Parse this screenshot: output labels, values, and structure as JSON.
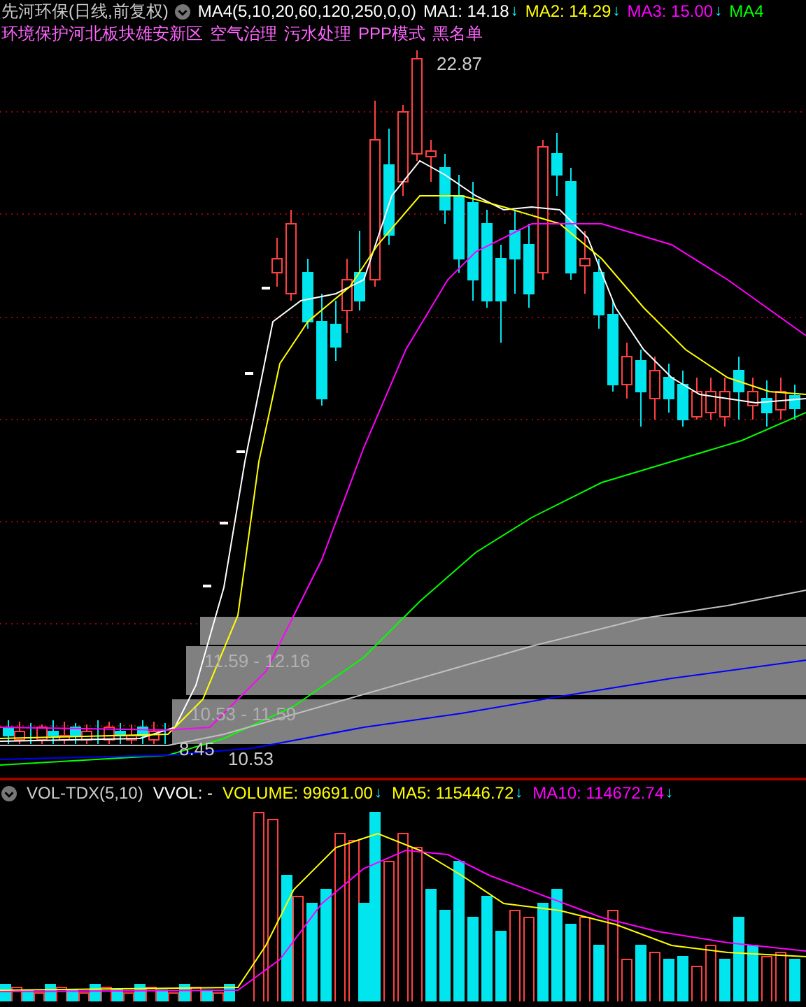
{
  "header": {
    "title": "先河环保(日线,前复权)",
    "indicator": "MA4(5,10,20,60,120,250,0,0)",
    "averages": [
      {
        "label": "MA1: 14.18",
        "color": "#ffffff",
        "arrow": "↓"
      },
      {
        "label": "MA2: 14.29",
        "color": "#ffff00",
        "arrow": "↓"
      },
      {
        "label": "MA3: 15.00",
        "color": "#ff00ff",
        "arrow": "↓"
      },
      {
        "label": "MA4",
        "color": "#00ff00"
      }
    ]
  },
  "concept_tags": [
    "环境保护河北板块雄安新区",
    "空气治理",
    "污水处理",
    "PPP模式",
    "黑名单"
  ],
  "price_chart": {
    "high_label": "22.87",
    "chip_ranges": [
      "11.59 - 12.16",
      "10.53 - 11.59"
    ],
    "low_labels": [
      "8.45",
      "10.53"
    ]
  },
  "volume_panel": {
    "indicator": "VOL-TDX(5,10)",
    "vvol": "VVOL: -",
    "readings": [
      {
        "label": "VOLUME: 99691.00",
        "color": "#ffff00",
        "arrow": "↓"
      },
      {
        "label": "MA5: 115446.72",
        "color": "#ffff00",
        "arrow": "↓"
      },
      {
        "label": "MA10: 114672.74",
        "color": "#ff00ff",
        "arrow": "↓"
      }
    ]
  }
}
